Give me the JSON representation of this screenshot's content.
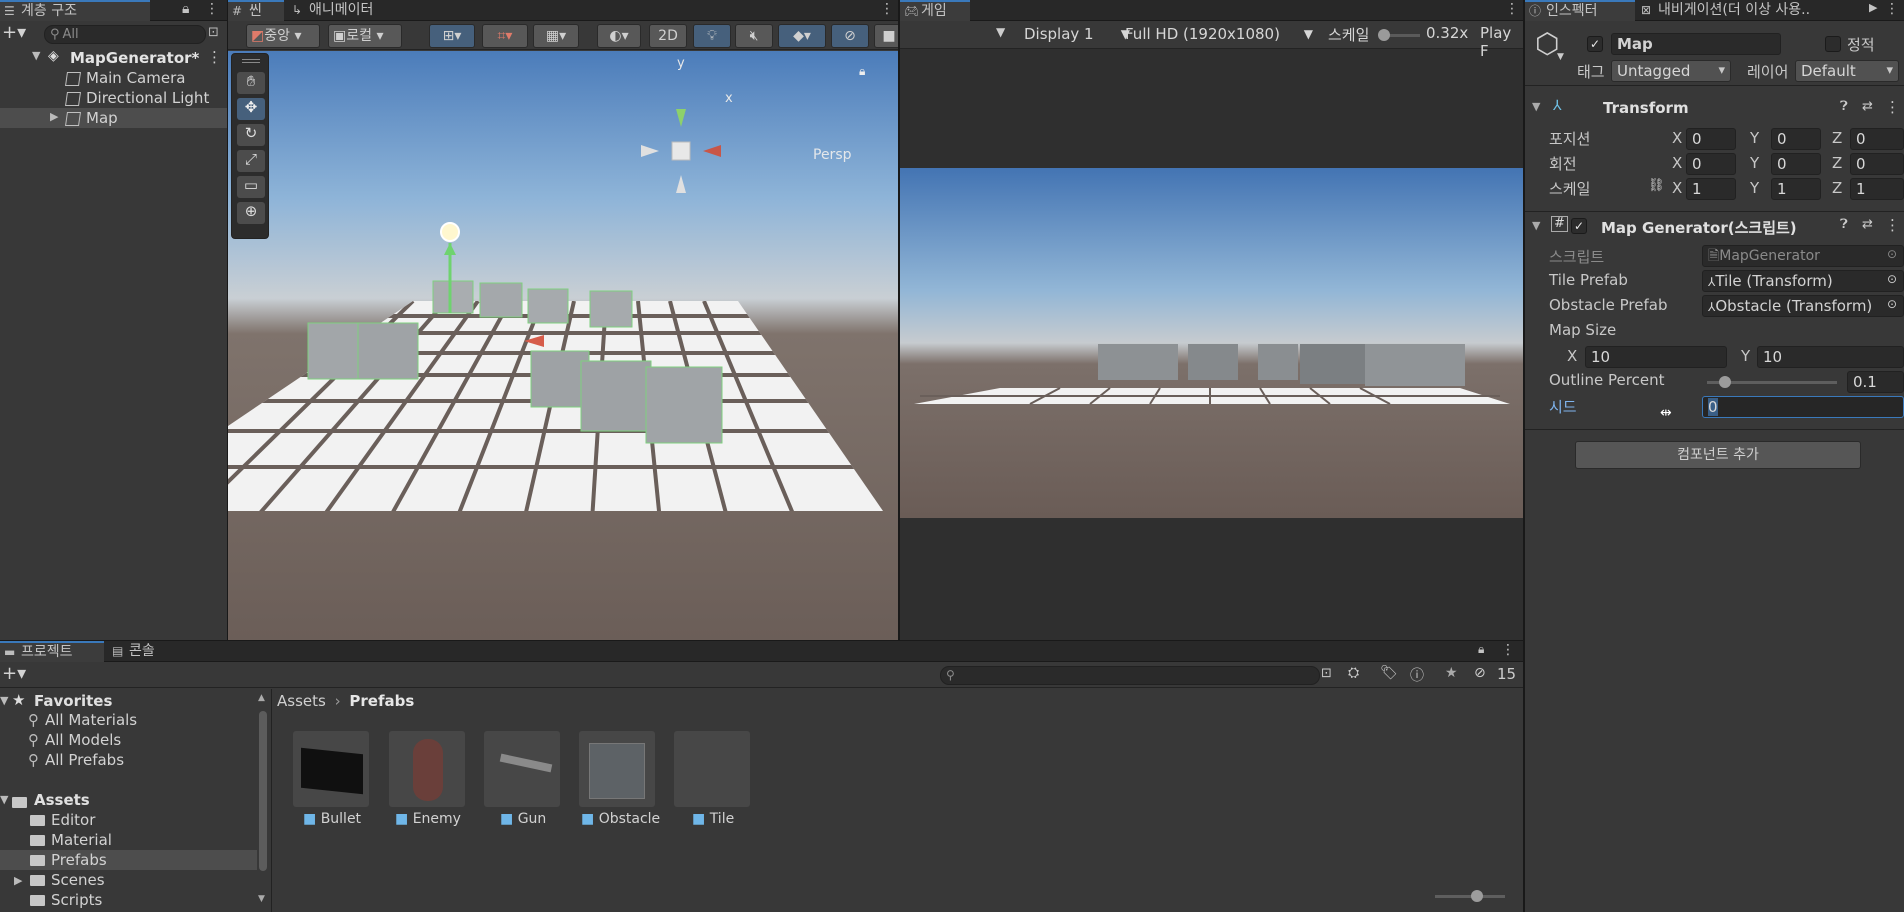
{
  "hierarchy": {
    "tab_label": "계층 구조",
    "search_placeholder": "All",
    "scene_name": "MapGenerator*",
    "items": [
      {
        "label": "Main Camera"
      },
      {
        "label": "Directional Light"
      },
      {
        "label": "Map"
      }
    ]
  },
  "scene": {
    "tab_scene": "씬",
    "tab_animator": "애니메이터",
    "pivot_label": "중앙",
    "space_label": "로컬",
    "mode_2d": "2D",
    "persp_label": "Persp",
    "gizmo_y": "y",
    "gizmo_x": "x"
  },
  "game": {
    "tab_label": "게임",
    "display": "Display 1",
    "resolution": "Full HD (1920x1080)",
    "scale_label": "스케일",
    "scale_value": "0.32x",
    "play_label": "Play F"
  },
  "inspector": {
    "tab_inspector": "인스펙터",
    "tab_navigation": "내비게이션(더 이상 사용..",
    "object_name": "Map",
    "static_label": "정적",
    "tag_label": "태그",
    "tag_value": "Untagged",
    "layer_label": "레이어",
    "layer_value": "Default",
    "transform": {
      "title": "Transform",
      "rows": [
        {
          "label": "포지션",
          "x": "0",
          "y": "0",
          "z": "0"
        },
        {
          "label": "회전",
          "x": "0",
          "y": "0",
          "z": "0"
        },
        {
          "label": "스케일",
          "x": "1",
          "y": "1",
          "z": "1"
        }
      ],
      "x_label": "X",
      "y_label": "Y",
      "z_label": "Z"
    },
    "map_generator": {
      "title": "Map Generator(스크립트)",
      "script_label": "스크립트",
      "script_value": "MapGenerator",
      "tile_label": "Tile Prefab",
      "tile_value": "Tile (Transform)",
      "obstacle_label": "Obstacle Prefab",
      "obstacle_value": "Obstacle (Transform)",
      "map_size_label": "Map Size",
      "map_x": "10",
      "map_y": "10",
      "outline_label": "Outline Percent",
      "outline_value": "0.1",
      "outline_fraction": 0.1,
      "seed_label": "시드",
      "seed_value": "0"
    },
    "add_component": "컴포넌트 추가"
  },
  "project": {
    "tab_project": "프로젝트",
    "tab_console": "콘솔",
    "badge_count": "15",
    "favorites": {
      "title": "Favorites",
      "items": [
        "All Materials",
        "All Models",
        "All Prefabs"
      ]
    },
    "assets": {
      "title": "Assets",
      "items": [
        "Editor",
        "Material",
        "Prefabs",
        "Scenes",
        "Scripts"
      ]
    },
    "breadcrumb": {
      "root": "Assets",
      "sep": "›",
      "current": "Prefabs"
    },
    "prefabs": [
      {
        "label": "Bullet"
      },
      {
        "label": "Enemy"
      },
      {
        "label": "Gun"
      },
      {
        "label": "Obstacle"
      },
      {
        "label": "Tile"
      }
    ]
  },
  "colors": {
    "accent": "#3a79bb",
    "panel_bg": "#383838",
    "sky_top": "#3e6ea8",
    "ground": "#6b5f5a"
  }
}
